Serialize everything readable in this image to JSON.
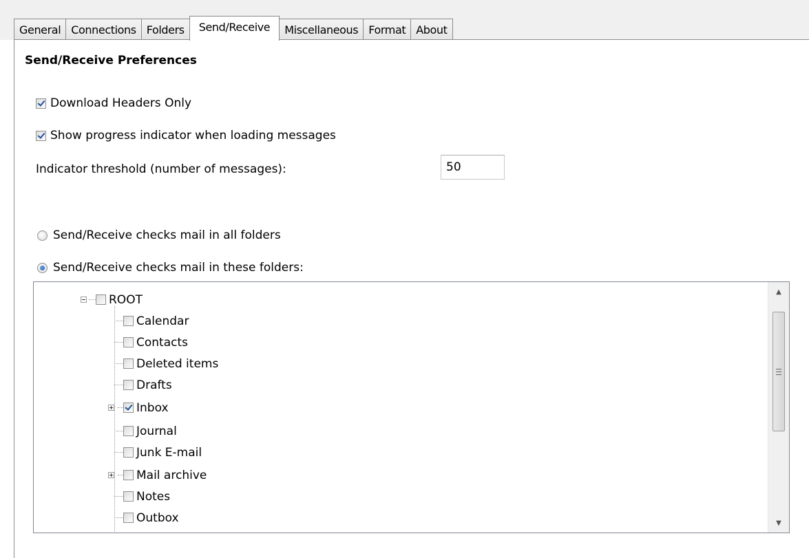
{
  "tabs": [
    {
      "label": "General",
      "active": false
    },
    {
      "label": "Connections",
      "active": false
    },
    {
      "label": "Folders",
      "active": false
    },
    {
      "label": "Send/Receive",
      "active": true
    },
    {
      "label": "Miscellaneous",
      "active": false
    },
    {
      "label": "Format",
      "active": false
    },
    {
      "label": "About",
      "active": false
    }
  ],
  "section_title": "Send/Receive Preferences",
  "options": {
    "download_headers_only": {
      "label": "Download Headers Only",
      "checked": true
    },
    "show_progress": {
      "label": "Show progress indicator when loading messages",
      "checked": true
    },
    "threshold": {
      "label": "Indicator threshold (number of messages):",
      "value": "50"
    },
    "radio_all": {
      "label": "Send/Receive checks mail in all folders",
      "selected": false
    },
    "radio_these": {
      "label": "Send/Receive checks mail in these folders:",
      "selected": true
    }
  },
  "tree": {
    "root": {
      "label": "ROOT",
      "checked": false,
      "expanded": true
    },
    "children": [
      {
        "label": "Calendar",
        "checked": false,
        "has_children": false
      },
      {
        "label": "Contacts",
        "checked": false,
        "has_children": false
      },
      {
        "label": "Deleted items",
        "checked": false,
        "has_children": false
      },
      {
        "label": "Drafts",
        "checked": false,
        "has_children": false
      },
      {
        "label": "Inbox",
        "checked": true,
        "has_children": true
      },
      {
        "label": "Journal",
        "checked": false,
        "has_children": false
      },
      {
        "label": "Junk E-mail",
        "checked": false,
        "has_children": false
      },
      {
        "label": "Mail archive",
        "checked": false,
        "has_children": true
      },
      {
        "label": "Notes",
        "checked": false,
        "has_children": false
      },
      {
        "label": "Outbox",
        "checked": false,
        "has_children": false
      }
    ]
  },
  "scrollbar": {
    "up_icon": "▲",
    "down_icon": "▼"
  }
}
